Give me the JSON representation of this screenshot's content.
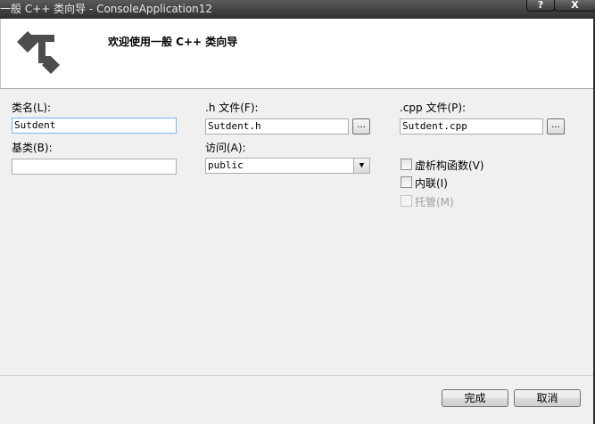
{
  "window": {
    "title": "一般 C++ 类向导 - ConsoleApplication12",
    "help_label": "?",
    "close_label": "X"
  },
  "header": {
    "title": "欢迎使用一般 C++ 类向导"
  },
  "form": {
    "class_name_label": "类名(L):",
    "class_name_value": "Sutdent",
    "base_class_label": "基类(B):",
    "base_class_value": "",
    "h_file_label": ".h 文件(F):",
    "h_file_value": "Sutdent.h",
    "access_label": "访问(A):",
    "access_value": "public",
    "cpp_file_label": ".cpp 文件(P):",
    "cpp_file_value": "Sutdent.cpp",
    "browse_label": "...",
    "virtual_destructor_label": "虚析构函数(V)",
    "virtual_destructor_checked": false,
    "inline_label": "内联(I)",
    "inline_checked": false,
    "managed_label": "托管(M)",
    "managed_checked": false,
    "managed_enabled": false
  },
  "buttons": {
    "finish_label": "完成",
    "cancel_label": "取消"
  }
}
